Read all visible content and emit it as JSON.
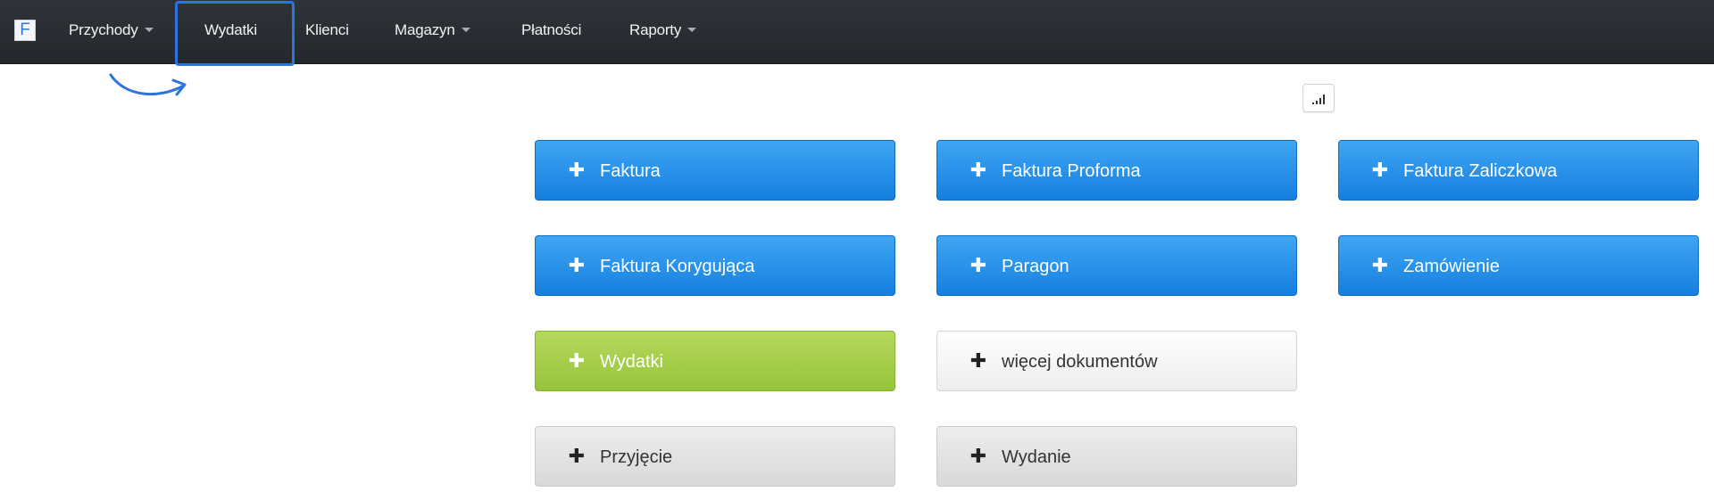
{
  "navbar": {
    "brand_letter": "F",
    "items": [
      {
        "label": "Przychody",
        "dropdown": true
      },
      {
        "label": "Wydatki",
        "dropdown": false,
        "active": true
      },
      {
        "label": "Klienci",
        "dropdown": false
      },
      {
        "label": "Magazyn",
        "dropdown": true
      },
      {
        "label": "Płatności",
        "dropdown": false
      },
      {
        "label": "Raporty",
        "dropdown": true
      }
    ],
    "highlight_color": "#2f74dd"
  },
  "toolbar": {
    "chart_icon": "signal-bars-icon"
  },
  "documents": [
    {
      "label": "Faktura",
      "style": "blue"
    },
    {
      "label": "Faktura Proforma",
      "style": "blue"
    },
    {
      "label": "Faktura Zaliczkowa",
      "style": "blue"
    },
    {
      "label": "Faktura Korygująca",
      "style": "blue"
    },
    {
      "label": "Paragon",
      "style": "blue"
    },
    {
      "label": "Zamówienie",
      "style": "blue"
    },
    {
      "label": "Wydatki",
      "style": "green"
    },
    {
      "label": "więcej dokumentów",
      "style": "white"
    },
    {
      "label": "Przyjęcie",
      "style": "gray"
    },
    {
      "label": "Wydanie",
      "style": "gray"
    }
  ],
  "plus_glyph": "✚",
  "colors": {
    "primary_blue": "#1f8ae6",
    "success_green": "#a5ce4a",
    "navbar_bg": "#2b3035"
  }
}
